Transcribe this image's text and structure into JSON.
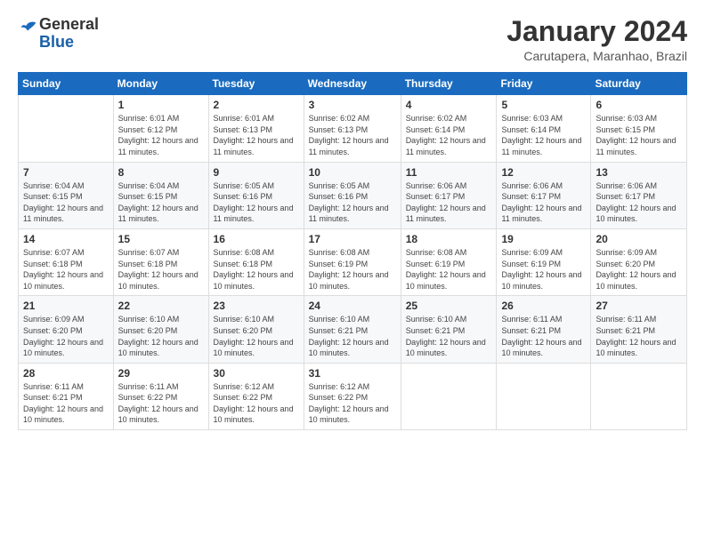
{
  "logo": {
    "general": "General",
    "blue": "Blue"
  },
  "header": {
    "month_title": "January 2024",
    "location": "Carutapera, Maranhao, Brazil"
  },
  "days_of_week": [
    "Sunday",
    "Monday",
    "Tuesday",
    "Wednesday",
    "Thursday",
    "Friday",
    "Saturday"
  ],
  "weeks": [
    [
      {
        "day": "",
        "sunrise": "",
        "sunset": "",
        "daylight": ""
      },
      {
        "day": "1",
        "sunrise": "Sunrise: 6:01 AM",
        "sunset": "Sunset: 6:12 PM",
        "daylight": "Daylight: 12 hours and 11 minutes."
      },
      {
        "day": "2",
        "sunrise": "Sunrise: 6:01 AM",
        "sunset": "Sunset: 6:13 PM",
        "daylight": "Daylight: 12 hours and 11 minutes."
      },
      {
        "day": "3",
        "sunrise": "Sunrise: 6:02 AM",
        "sunset": "Sunset: 6:13 PM",
        "daylight": "Daylight: 12 hours and 11 minutes."
      },
      {
        "day": "4",
        "sunrise": "Sunrise: 6:02 AM",
        "sunset": "Sunset: 6:14 PM",
        "daylight": "Daylight: 12 hours and 11 minutes."
      },
      {
        "day": "5",
        "sunrise": "Sunrise: 6:03 AM",
        "sunset": "Sunset: 6:14 PM",
        "daylight": "Daylight: 12 hours and 11 minutes."
      },
      {
        "day": "6",
        "sunrise": "Sunrise: 6:03 AM",
        "sunset": "Sunset: 6:15 PM",
        "daylight": "Daylight: 12 hours and 11 minutes."
      }
    ],
    [
      {
        "day": "7",
        "sunrise": "Sunrise: 6:04 AM",
        "sunset": "Sunset: 6:15 PM",
        "daylight": "Daylight: 12 hours and 11 minutes."
      },
      {
        "day": "8",
        "sunrise": "Sunrise: 6:04 AM",
        "sunset": "Sunset: 6:15 PM",
        "daylight": "Daylight: 12 hours and 11 minutes."
      },
      {
        "day": "9",
        "sunrise": "Sunrise: 6:05 AM",
        "sunset": "Sunset: 6:16 PM",
        "daylight": "Daylight: 12 hours and 11 minutes."
      },
      {
        "day": "10",
        "sunrise": "Sunrise: 6:05 AM",
        "sunset": "Sunset: 6:16 PM",
        "daylight": "Daylight: 12 hours and 11 minutes."
      },
      {
        "day": "11",
        "sunrise": "Sunrise: 6:06 AM",
        "sunset": "Sunset: 6:17 PM",
        "daylight": "Daylight: 12 hours and 11 minutes."
      },
      {
        "day": "12",
        "sunrise": "Sunrise: 6:06 AM",
        "sunset": "Sunset: 6:17 PM",
        "daylight": "Daylight: 12 hours and 11 minutes."
      },
      {
        "day": "13",
        "sunrise": "Sunrise: 6:06 AM",
        "sunset": "Sunset: 6:17 PM",
        "daylight": "Daylight: 12 hours and 10 minutes."
      }
    ],
    [
      {
        "day": "14",
        "sunrise": "Sunrise: 6:07 AM",
        "sunset": "Sunset: 6:18 PM",
        "daylight": "Daylight: 12 hours and 10 minutes."
      },
      {
        "day": "15",
        "sunrise": "Sunrise: 6:07 AM",
        "sunset": "Sunset: 6:18 PM",
        "daylight": "Daylight: 12 hours and 10 minutes."
      },
      {
        "day": "16",
        "sunrise": "Sunrise: 6:08 AM",
        "sunset": "Sunset: 6:18 PM",
        "daylight": "Daylight: 12 hours and 10 minutes."
      },
      {
        "day": "17",
        "sunrise": "Sunrise: 6:08 AM",
        "sunset": "Sunset: 6:19 PM",
        "daylight": "Daylight: 12 hours and 10 minutes."
      },
      {
        "day": "18",
        "sunrise": "Sunrise: 6:08 AM",
        "sunset": "Sunset: 6:19 PM",
        "daylight": "Daylight: 12 hours and 10 minutes."
      },
      {
        "day": "19",
        "sunrise": "Sunrise: 6:09 AM",
        "sunset": "Sunset: 6:19 PM",
        "daylight": "Daylight: 12 hours and 10 minutes."
      },
      {
        "day": "20",
        "sunrise": "Sunrise: 6:09 AM",
        "sunset": "Sunset: 6:20 PM",
        "daylight": "Daylight: 12 hours and 10 minutes."
      }
    ],
    [
      {
        "day": "21",
        "sunrise": "Sunrise: 6:09 AM",
        "sunset": "Sunset: 6:20 PM",
        "daylight": "Daylight: 12 hours and 10 minutes."
      },
      {
        "day": "22",
        "sunrise": "Sunrise: 6:10 AM",
        "sunset": "Sunset: 6:20 PM",
        "daylight": "Daylight: 12 hours and 10 minutes."
      },
      {
        "day": "23",
        "sunrise": "Sunrise: 6:10 AM",
        "sunset": "Sunset: 6:20 PM",
        "daylight": "Daylight: 12 hours and 10 minutes."
      },
      {
        "day": "24",
        "sunrise": "Sunrise: 6:10 AM",
        "sunset": "Sunset: 6:21 PM",
        "daylight": "Daylight: 12 hours and 10 minutes."
      },
      {
        "day": "25",
        "sunrise": "Sunrise: 6:10 AM",
        "sunset": "Sunset: 6:21 PM",
        "daylight": "Daylight: 12 hours and 10 minutes."
      },
      {
        "day": "26",
        "sunrise": "Sunrise: 6:11 AM",
        "sunset": "Sunset: 6:21 PM",
        "daylight": "Daylight: 12 hours and 10 minutes."
      },
      {
        "day": "27",
        "sunrise": "Sunrise: 6:11 AM",
        "sunset": "Sunset: 6:21 PM",
        "daylight": "Daylight: 12 hours and 10 minutes."
      }
    ],
    [
      {
        "day": "28",
        "sunrise": "Sunrise: 6:11 AM",
        "sunset": "Sunset: 6:21 PM",
        "daylight": "Daylight: 12 hours and 10 minutes."
      },
      {
        "day": "29",
        "sunrise": "Sunrise: 6:11 AM",
        "sunset": "Sunset: 6:22 PM",
        "daylight": "Daylight: 12 hours and 10 minutes."
      },
      {
        "day": "30",
        "sunrise": "Sunrise: 6:12 AM",
        "sunset": "Sunset: 6:22 PM",
        "daylight": "Daylight: 12 hours and 10 minutes."
      },
      {
        "day": "31",
        "sunrise": "Sunrise: 6:12 AM",
        "sunset": "Sunset: 6:22 PM",
        "daylight": "Daylight: 12 hours and 10 minutes."
      },
      {
        "day": "",
        "sunrise": "",
        "sunset": "",
        "daylight": ""
      },
      {
        "day": "",
        "sunrise": "",
        "sunset": "",
        "daylight": ""
      },
      {
        "day": "",
        "sunrise": "",
        "sunset": "",
        "daylight": ""
      }
    ]
  ]
}
